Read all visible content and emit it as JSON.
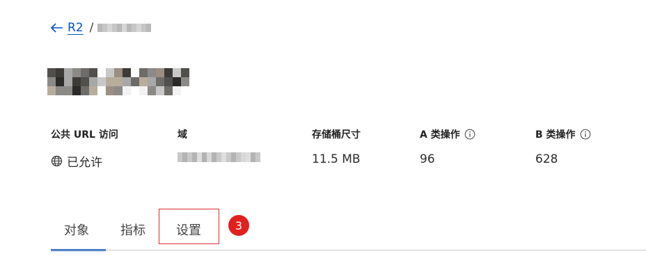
{
  "breadcrumb": {
    "back_label": "R2",
    "separator": "/"
  },
  "stats": [
    {
      "label": "公共 URL 访问",
      "value": "已允许",
      "icon": "globe-icon"
    },
    {
      "label": "域",
      "value": ""
    },
    {
      "label": "存储桶尺寸",
      "value": "11.5 MB"
    },
    {
      "label": "A 类操作",
      "value": "96",
      "icon": "info-icon"
    },
    {
      "label": "B 类操作",
      "value": "628",
      "icon": "info-icon"
    }
  ],
  "tabs": [
    {
      "label": "对象",
      "active": true
    },
    {
      "label": "指标",
      "active": false
    },
    {
      "label": "设置",
      "active": false
    }
  ],
  "annotation": {
    "step_number": "3"
  },
  "colors": {
    "accent": "#0051c3",
    "annotation_red": "#e0201e"
  }
}
